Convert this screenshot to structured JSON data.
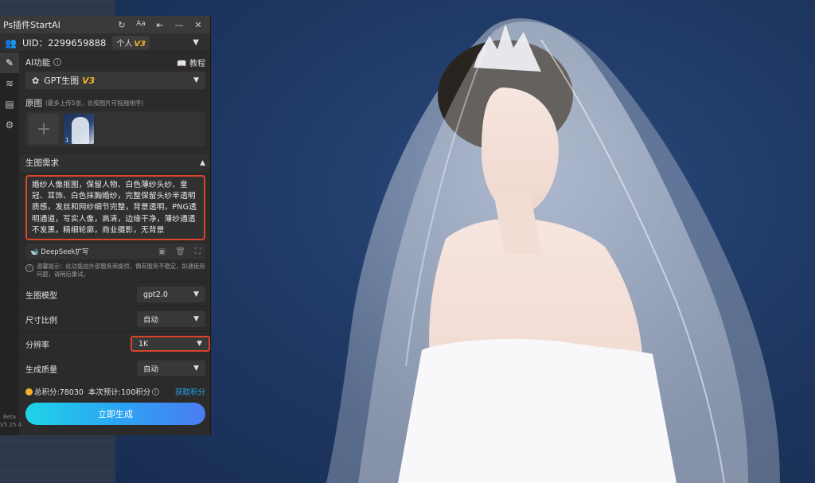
{
  "app": {
    "title": "Ps插件StartAI",
    "titlebar_icons": [
      "refresh-icon",
      "font-size-icon",
      "pin-icon",
      "minimize-icon",
      "close-icon"
    ]
  },
  "account": {
    "uid_text": "UID：2299659888",
    "plan_label": "个人",
    "plan_version": "V3"
  },
  "sidebar": {
    "items": [
      "brush-icon",
      "layers-icon",
      "document-icon",
      "gear-icon"
    ],
    "beta_label": "Beta",
    "version": "V5.25.4"
  },
  "ai_function": {
    "label": "AI功能",
    "tutorial_label": "教程",
    "selected": "GPT生图",
    "selected_version": "V3"
  },
  "source_image": {
    "label": "原图",
    "hint": "(最多上传5张，长按图片可拖拽排序)",
    "thumb_index": "1"
  },
  "prompt": {
    "section_label": "生图需求",
    "text": "婚纱人像抠图，保留人物、白色薄纱头纱、皇冠、耳饰、白色抹胸婚纱，完整保留头纱半透明质感，发丝和网纱细节完整，背景透明，PNG透明通道，写实人像，高清，边缘干净，薄纱通透不发黑，精细轮廓，商业摄影，无背景",
    "deepseek_label": "DeepSeek扩写",
    "notice": "温馨提示：此功能由外部服务商提供，偶有服务不稳定，如遇使用问题，请稍后重试。"
  },
  "settings": [
    {
      "label": "生图模型",
      "value": "gpt2.0"
    },
    {
      "label": "尺寸比例",
      "value": "自动"
    },
    {
      "label": "分辨率",
      "value": "1K"
    },
    {
      "label": "生成质量",
      "value": "自动"
    }
  ],
  "points": {
    "total_text": "总积分:78030",
    "estimate_text": "本次预计:100积分",
    "get_points_label": "获取积分"
  },
  "generate_button": "立即生成",
  "colors": {
    "highlight_border": "#d9442b",
    "accent_gold": "#f0b429",
    "link_blue": "#25a8f0"
  }
}
